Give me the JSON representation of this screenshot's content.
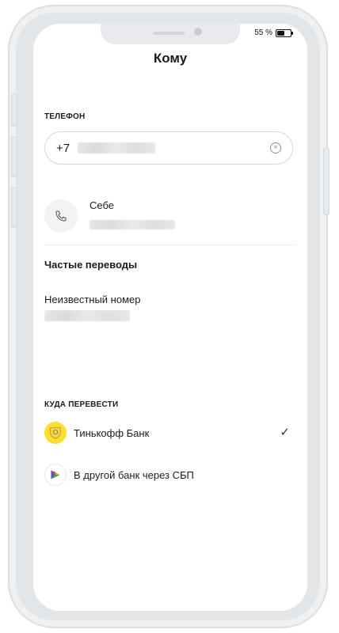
{
  "status_bar": {
    "battery_text": "55 %",
    "battery_level": 0.55
  },
  "header": {
    "title": "Кому"
  },
  "phone_section": {
    "label": "ТЕЛЕФОН",
    "prefix": "+7",
    "clear_icon": "clear-circle-x"
  },
  "self_contact": {
    "icon": "phone-handset",
    "name": "Себе"
  },
  "frequent": {
    "title": "Частые переводы",
    "items": [
      {
        "name": "Неизвестный номер"
      }
    ]
  },
  "destination": {
    "label": "КУДА ПЕРЕВЕСТИ",
    "banks": [
      {
        "name": "Тинькофф Банк",
        "selected": true,
        "icon": "tinkoff-logo",
        "color": "#ffdd2d"
      },
      {
        "name": "В другой банк через СБП",
        "selected": false,
        "icon": "sbp-logo"
      }
    ],
    "check_glyph": "✓"
  }
}
